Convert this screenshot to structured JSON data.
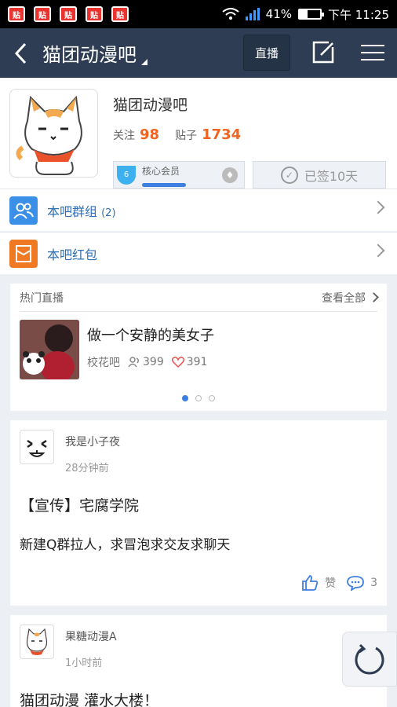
{
  "status_bar": {
    "notifications": [
      "贴",
      "贴",
      "贴",
      "贴",
      "贴"
    ],
    "battery": "41%",
    "time": "下午 11:25"
  },
  "header": {
    "title": "猫团动漫吧",
    "live_label": "直播"
  },
  "forum": {
    "name": "猫团动漫吧",
    "follow_label": "关注",
    "follow_count": "98",
    "posts_label": "贴子",
    "posts_count": "1734",
    "member_level": "6",
    "member_label": "核心会员",
    "signed_label": "已签10天"
  },
  "rows": [
    {
      "label": "本吧群组",
      "count": "(2)"
    },
    {
      "label": "本吧红包"
    }
  ],
  "live": {
    "section_title": "热门直播",
    "see_all": "查看全部",
    "item_title": "做一个安静的美女子",
    "forum": "校花吧",
    "viewers": "399",
    "likes": "391",
    "carousel_pages": 3,
    "carousel_active": 0
  },
  "posts": [
    {
      "author": "我是小子夜",
      "time": "28分钟前",
      "title": "【宣传】宅腐学院",
      "body": "新建Q群拉人，求冒泡求交友求聊天",
      "like_label": "赞",
      "comments": "3"
    },
    {
      "author": "果糖动漫A",
      "time": "1小时前",
      "title": "猫团动漫 灌水大楼！"
    }
  ],
  "colors": {
    "header_bg": "#2e3d53",
    "accent_orange": "#f06423",
    "link_blue": "#2f6fb5"
  }
}
